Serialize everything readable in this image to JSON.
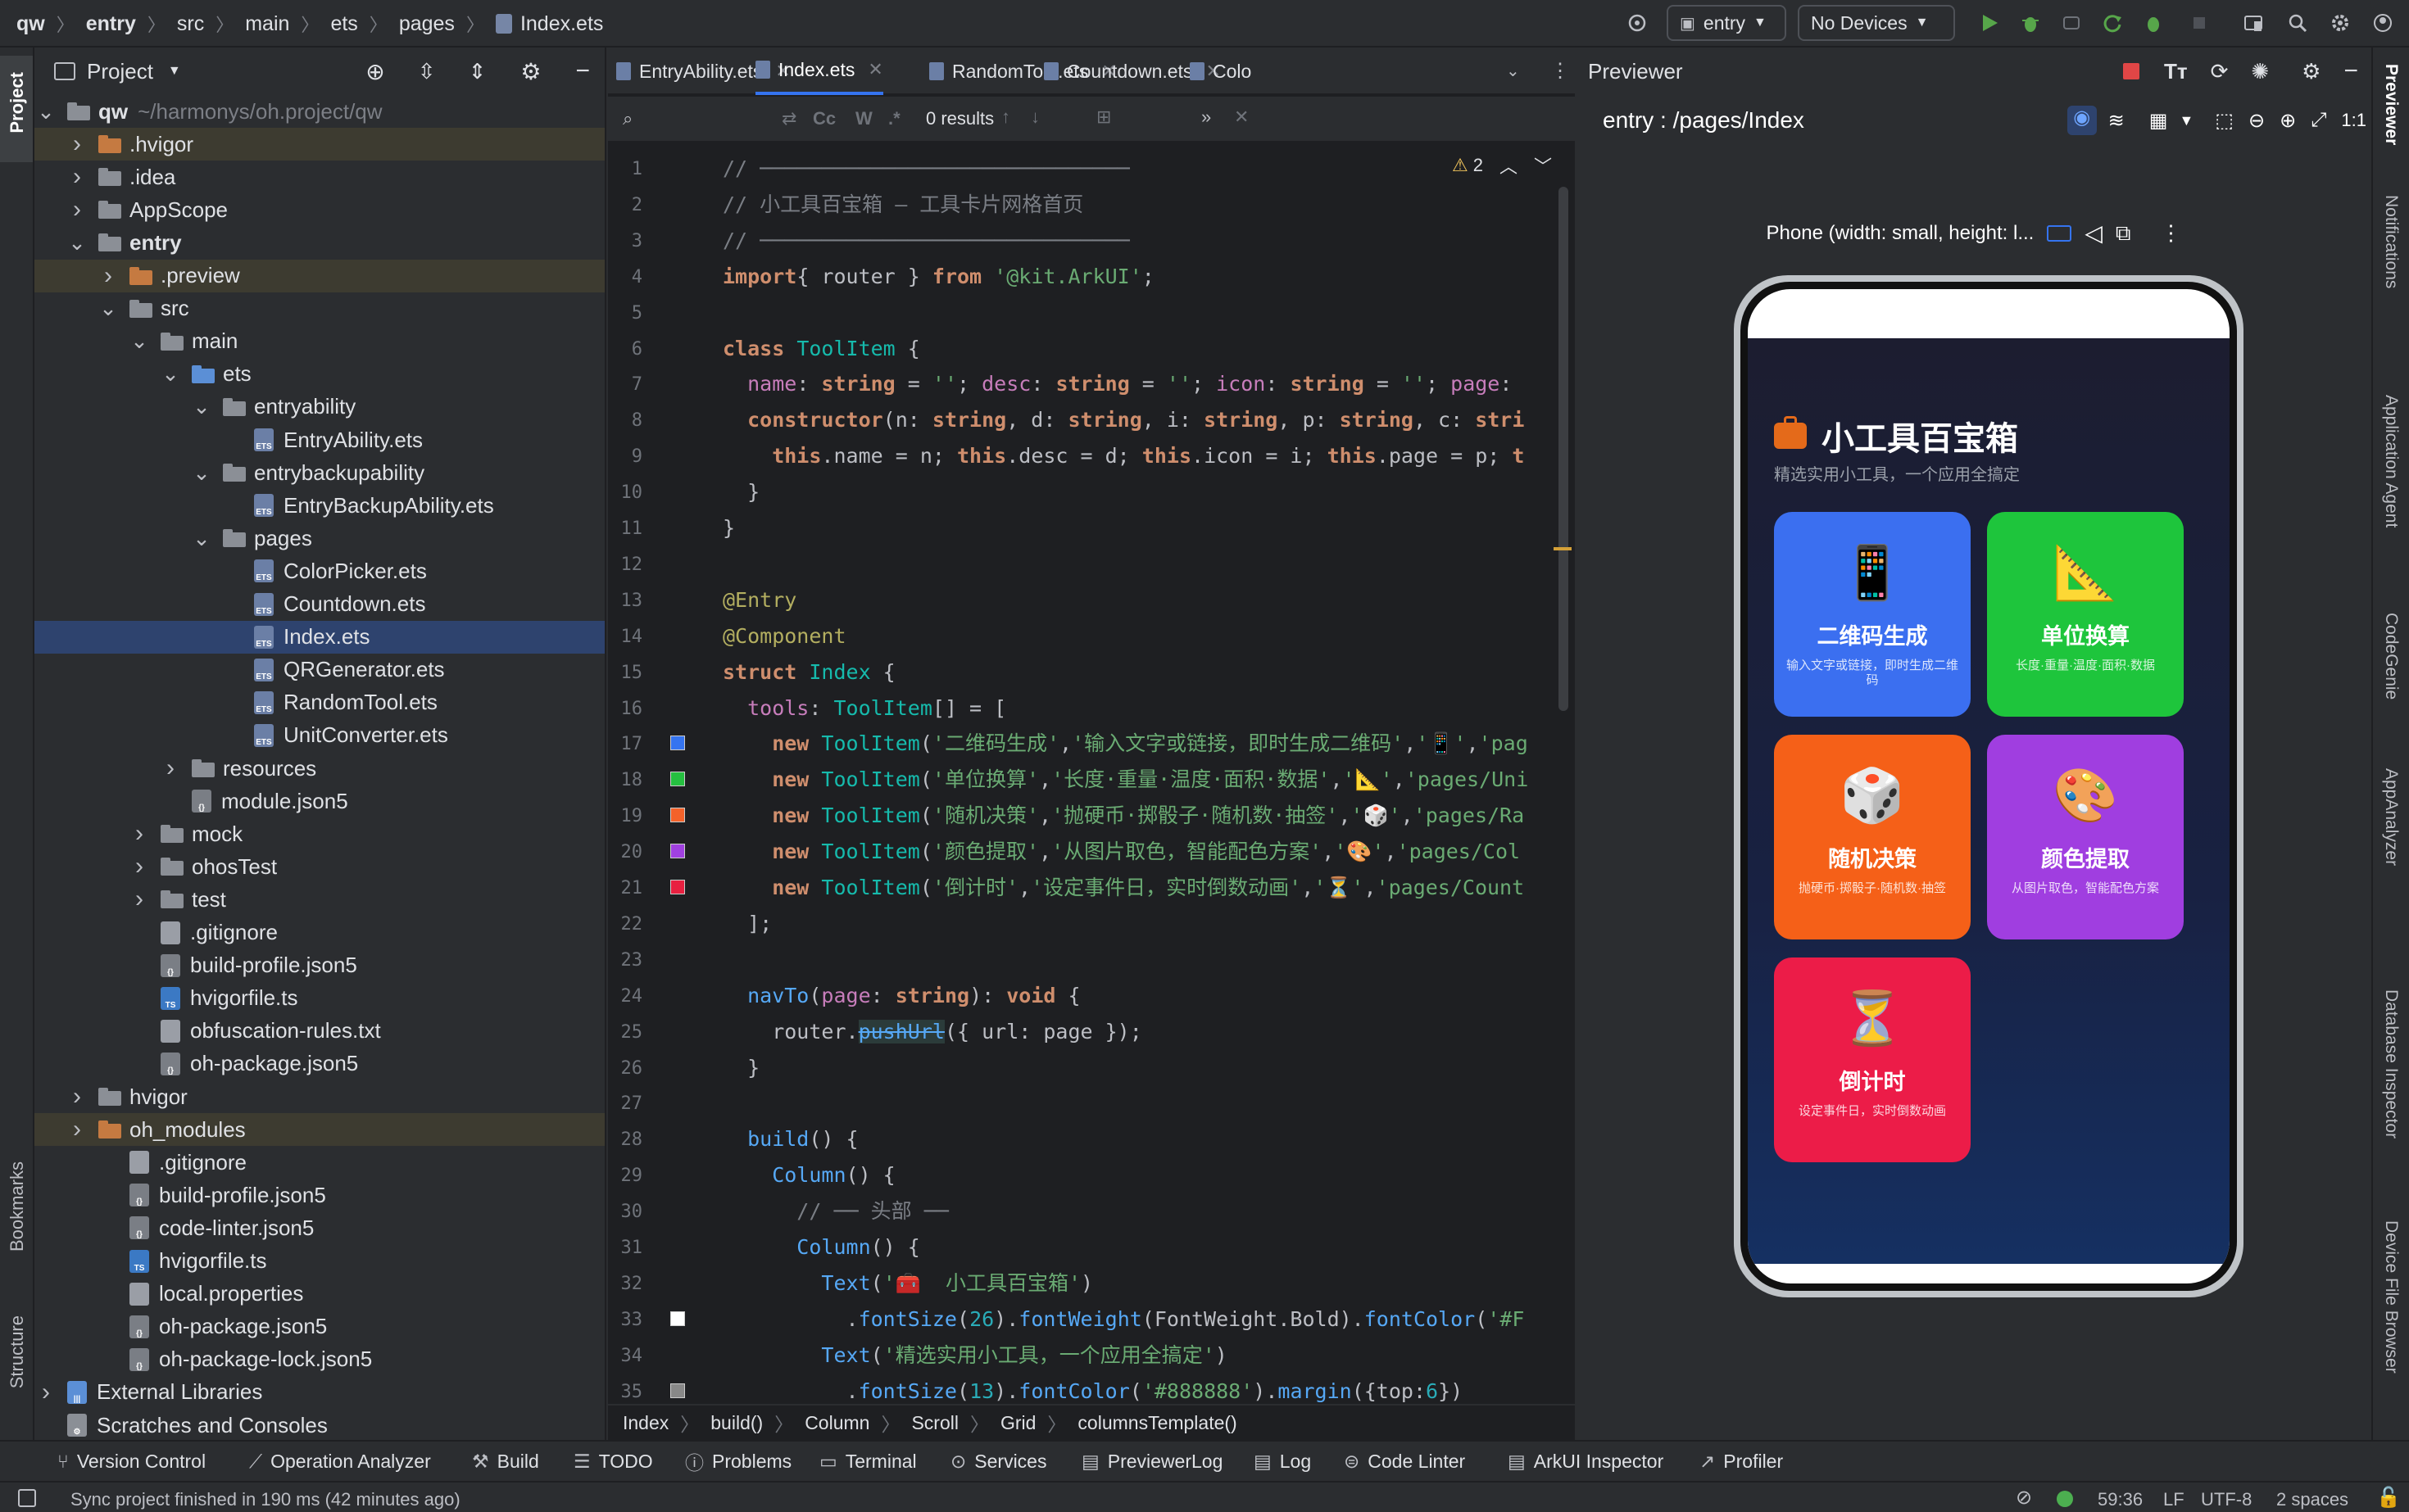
{
  "topbar": {
    "breadcrumbs": [
      "qw",
      "entry",
      "src",
      "main",
      "ets",
      "pages",
      "Index.ets"
    ],
    "run_config": "entry",
    "device": "No Devices"
  },
  "left_strip": {
    "project": "Project",
    "bookmarks": "Bookmarks",
    "structure": "Structure"
  },
  "project": {
    "title": "Project",
    "tree": [
      {
        "label": "qw",
        "extra": "~/harmonys/oh.project/qw",
        "depth": 0,
        "type": "folder",
        "open": true,
        "bold": true
      },
      {
        "label": ".hvigor",
        "depth": 1,
        "type": "folder-orange",
        "open": false,
        "hl": true
      },
      {
        "label": ".idea",
        "depth": 1,
        "type": "folder",
        "open": false
      },
      {
        "label": "AppScope",
        "depth": 1,
        "type": "folder",
        "open": false
      },
      {
        "label": "entry",
        "depth": 1,
        "type": "folder",
        "open": true,
        "bold": true
      },
      {
        "label": ".preview",
        "depth": 2,
        "type": "folder-orange",
        "open": false,
        "hl": true
      },
      {
        "label": "src",
        "depth": 2,
        "type": "folder",
        "open": true
      },
      {
        "label": "main",
        "depth": 3,
        "type": "folder",
        "open": true
      },
      {
        "label": "ets",
        "depth": 4,
        "type": "folder-blue",
        "open": true
      },
      {
        "label": "entryability",
        "depth": 5,
        "type": "folder",
        "open": true
      },
      {
        "label": "EntryAbility.ets",
        "depth": 6,
        "type": "ets"
      },
      {
        "label": "entrybackupability",
        "depth": 5,
        "type": "folder",
        "open": true
      },
      {
        "label": "EntryBackupAbility.ets",
        "depth": 6,
        "type": "ets"
      },
      {
        "label": "pages",
        "depth": 5,
        "type": "folder",
        "open": true
      },
      {
        "label": "ColorPicker.ets",
        "depth": 6,
        "type": "ets"
      },
      {
        "label": "Countdown.ets",
        "depth": 6,
        "type": "ets"
      },
      {
        "label": "Index.ets",
        "depth": 6,
        "type": "ets",
        "sel": true
      },
      {
        "label": "QRGenerator.ets",
        "depth": 6,
        "type": "ets"
      },
      {
        "label": "RandomTool.ets",
        "depth": 6,
        "type": "ets"
      },
      {
        "label": "UnitConverter.ets",
        "depth": 6,
        "type": "ets"
      },
      {
        "label": "resources",
        "depth": 4,
        "type": "folder",
        "open": false
      },
      {
        "label": "module.json5",
        "depth": 4,
        "type": "json"
      },
      {
        "label": "mock",
        "depth": 3,
        "type": "folder",
        "open": false
      },
      {
        "label": "ohosTest",
        "depth": 3,
        "type": "folder",
        "open": false
      },
      {
        "label": "test",
        "depth": 3,
        "type": "folder",
        "open": false
      },
      {
        "label": ".gitignore",
        "depth": 3,
        "type": "file"
      },
      {
        "label": "build-profile.json5",
        "depth": 3,
        "type": "json"
      },
      {
        "label": "hvigorfile.ts",
        "depth": 3,
        "type": "ts"
      },
      {
        "label": "obfuscation-rules.txt",
        "depth": 3,
        "type": "file"
      },
      {
        "label": "oh-package.json5",
        "depth": 3,
        "type": "json"
      },
      {
        "label": "hvigor",
        "depth": 1,
        "type": "folder",
        "open": false
      },
      {
        "label": "oh_modules",
        "depth": 1,
        "type": "folder-orange",
        "open": false,
        "hl": true
      },
      {
        "label": ".gitignore",
        "depth": 2,
        "type": "file"
      },
      {
        "label": "build-profile.json5",
        "depth": 2,
        "type": "json"
      },
      {
        "label": "code-linter.json5",
        "depth": 2,
        "type": "json"
      },
      {
        "label": "hvigorfile.ts",
        "depth": 2,
        "type": "ts"
      },
      {
        "label": "local.properties",
        "depth": 2,
        "type": "file"
      },
      {
        "label": "oh-package.json5",
        "depth": 2,
        "type": "json"
      },
      {
        "label": "oh-package-lock.json5",
        "depth": 2,
        "type": "json"
      },
      {
        "label": "External Libraries",
        "depth": 0,
        "type": "lib",
        "open": false
      },
      {
        "label": "Scratches and Consoles",
        "depth": 0,
        "type": "scratch"
      }
    ]
  },
  "editor": {
    "tabs": [
      "EntryAbility.ets",
      "Index.ets",
      "RandomTool.ets",
      "Countdown.ets",
      "Colo"
    ],
    "active_tab": 1,
    "find_results": "0 results",
    "warnings": "2",
    "lines": [
      [
        [
          "cm",
          "// ──────────────────────────────"
        ]
      ],
      [
        [
          "cm",
          "// 小工具百宝箱 — 工具卡片网格首页"
        ]
      ],
      [
        [
          "cm",
          "// ──────────────────────────────"
        ]
      ],
      [
        [
          "kw",
          "import"
        ],
        [
          "",
          "{ router } "
        ],
        [
          "kw",
          "from"
        ],
        [
          "st",
          " '@kit.ArkUI'"
        ],
        [
          "",
          ";"
        ]
      ],
      [],
      [
        [
          "kw",
          "class "
        ],
        [
          "ty",
          "ToolItem"
        ],
        [
          "",
          " {"
        ]
      ],
      [
        [
          "",
          ""
        ],
        [
          "pr",
          "  name"
        ],
        [
          "",
          ": "
        ],
        [
          "kw",
          "string"
        ],
        [
          "",
          " = "
        ],
        [
          "st",
          "''"
        ],
        [
          "",
          "; "
        ],
        [
          "pr",
          "desc"
        ],
        [
          "",
          ": "
        ],
        [
          "kw",
          "string"
        ],
        [
          "",
          " = "
        ],
        [
          "st",
          "''"
        ],
        [
          "",
          "; "
        ],
        [
          "pr",
          "icon"
        ],
        [
          "",
          ": "
        ],
        [
          "kw",
          "string"
        ],
        [
          "",
          " = "
        ],
        [
          "st",
          "''"
        ],
        [
          "",
          "; "
        ],
        [
          "pr",
          "page"
        ],
        [
          "",
          ":"
        ]
      ],
      [
        [
          "kw",
          "  constructor"
        ],
        [
          "",
          "(n: "
        ],
        [
          "kw",
          "string"
        ],
        [
          "",
          ", d: "
        ],
        [
          "kw",
          "string"
        ],
        [
          "",
          ", i: "
        ],
        [
          "kw",
          "string"
        ],
        [
          "",
          ", p: "
        ],
        [
          "kw",
          "string"
        ],
        [
          "",
          ", c: "
        ],
        [
          "kw",
          "stri"
        ]
      ],
      [
        [
          "kw",
          "    this"
        ],
        [
          "",
          ".name = n; "
        ],
        [
          "kw",
          "this"
        ],
        [
          "",
          ".desc = d; "
        ],
        [
          "kw",
          "this"
        ],
        [
          "",
          ".icon = i; "
        ],
        [
          "kw",
          "this"
        ],
        [
          "",
          ".page = p; "
        ],
        [
          "kw",
          "t"
        ]
      ],
      [
        [
          "",
          "  }"
        ]
      ],
      [
        [
          "",
          "}"
        ]
      ],
      [],
      [
        [
          "an",
          "@Entry"
        ]
      ],
      [
        [
          "an",
          "@Component"
        ]
      ],
      [
        [
          "kw",
          "struct "
        ],
        [
          "ty",
          "Index"
        ],
        [
          "",
          " {"
        ]
      ],
      [
        [
          "pr",
          "  tools"
        ],
        [
          "",
          ": "
        ],
        [
          "ty",
          "ToolItem"
        ],
        [
          "",
          "[] = ["
        ]
      ],
      [
        [
          "kw",
          "    new "
        ],
        [
          "ty",
          "ToolItem"
        ],
        [
          "",
          "("
        ],
        [
          "st",
          "'二维码生成'"
        ],
        [
          "",
          ","
        ],
        [
          "st",
          "'输入文字或链接，即时生成二维码'"
        ],
        [
          "",
          ","
        ],
        [
          "st",
          "'📱'"
        ],
        [
          "",
          ","
        ],
        [
          "st",
          "'pag"
        ]
      ],
      [
        [
          "kw",
          "    new "
        ],
        [
          "ty",
          "ToolItem"
        ],
        [
          "",
          "("
        ],
        [
          "st",
          "'单位换算'"
        ],
        [
          "",
          ","
        ],
        [
          "st",
          "'长度·重量·温度·面积·数据'"
        ],
        [
          "",
          ","
        ],
        [
          "st",
          "'📐'"
        ],
        [
          "",
          ","
        ],
        [
          "st",
          "'pages/Uni"
        ]
      ],
      [
        [
          "kw",
          "    new "
        ],
        [
          "ty",
          "ToolItem"
        ],
        [
          "",
          "("
        ],
        [
          "st",
          "'随机决策'"
        ],
        [
          "",
          ","
        ],
        [
          "st",
          "'抛硬币·掷骰子·随机数·抽签'"
        ],
        [
          "",
          ","
        ],
        [
          "st",
          "'🎲'"
        ],
        [
          "",
          ","
        ],
        [
          "st",
          "'pages/Ra"
        ]
      ],
      [
        [
          "kw",
          "    new "
        ],
        [
          "ty",
          "ToolItem"
        ],
        [
          "",
          "("
        ],
        [
          "st",
          "'颜色提取'"
        ],
        [
          "",
          ","
        ],
        [
          "st",
          "'从图片取色，智能配色方案'"
        ],
        [
          "",
          ","
        ],
        [
          "st",
          "'🎨'"
        ],
        [
          "",
          ","
        ],
        [
          "st",
          "'pages/Col"
        ]
      ],
      [
        [
          "kw",
          "    new "
        ],
        [
          "ty",
          "ToolItem"
        ],
        [
          "",
          "("
        ],
        [
          "st",
          "'倒计时'"
        ],
        [
          "",
          ","
        ],
        [
          "st",
          "'设定事件日，实时倒数动画'"
        ],
        [
          "",
          ","
        ],
        [
          "st",
          "'⏳'"
        ],
        [
          "",
          ","
        ],
        [
          "st",
          "'pages/Count"
        ]
      ],
      [
        [
          "",
          "  ];"
        ]
      ],
      [],
      [
        [
          "fn",
          "  navTo"
        ],
        [
          "",
          "("
        ],
        [
          "pr",
          "page"
        ],
        [
          "",
          ": "
        ],
        [
          "kw",
          "string"
        ],
        [
          "",
          "): "
        ],
        [
          "kw",
          "void"
        ],
        [
          "",
          " {"
        ]
      ],
      [
        [
          "",
          "    router."
        ],
        [
          "fn",
          "pushUrl"
        ],
        [
          "",
          "({ url: page });"
        ]
      ],
      [
        [
          "",
          "  }"
        ]
      ],
      [],
      [
        [
          "fn",
          "  build"
        ],
        [
          "",
          "() {"
        ]
      ],
      [
        [
          "fn",
          "    Column"
        ],
        [
          "",
          "() {"
        ]
      ],
      [
        [
          "cm",
          "      // ── 头部 ──"
        ]
      ],
      [
        [
          "fn",
          "      Column"
        ],
        [
          "",
          "() {"
        ]
      ],
      [
        [
          "fn",
          "        Text"
        ],
        [
          "",
          "("
        ],
        [
          "st",
          "'🧰  小工具百宝箱'"
        ],
        [
          "",
          ")"
        ]
      ],
      [
        [
          "",
          "          ."
        ],
        [
          "fn",
          "fontSize"
        ],
        [
          "",
          "("
        ],
        [
          "nb",
          "26"
        ],
        [
          "",
          ")."
        ],
        [
          "fn",
          "fontWeight"
        ],
        [
          "",
          "(FontWeight.Bold)."
        ],
        [
          "fn",
          "fontColor"
        ],
        [
          "",
          "("
        ],
        [
          "st",
          "'#F"
        ]
      ],
      [
        [
          "fn",
          "        Text"
        ],
        [
          "",
          "("
        ],
        [
          "st",
          "'精选实用小工具，一个应用全搞定'"
        ],
        [
          "",
          ")"
        ]
      ],
      [
        [
          "",
          "          ."
        ],
        [
          "fn",
          "fontSize"
        ],
        [
          "",
          "("
        ],
        [
          "nb",
          "13"
        ],
        [
          "",
          ")."
        ],
        [
          "fn",
          "fontColor"
        ],
        [
          "",
          "("
        ],
        [
          "st",
          "'#888888'"
        ],
        [
          "",
          ")."
        ],
        [
          "fn",
          "margin"
        ],
        [
          "",
          "({top:"
        ],
        [
          "nb",
          "6"
        ],
        [
          "",
          "})"
        ]
      ]
    ],
    "swatch_lines": {
      "17": "#3574f0",
      "18": "#25c040",
      "19": "#f4622a",
      "20": "#a040e0",
      "21": "#e82040",
      "33": "#ffffff",
      "35": "#888888"
    },
    "breadcrumb": [
      "Index",
      "build()",
      "Column",
      "Scroll",
      "Grid",
      "columnsTemplate()"
    ]
  },
  "previewer": {
    "title": "Previewer",
    "path": "entry : /pages/Index",
    "device_label": "Phone (width: small, height: l...",
    "app": {
      "title": "小工具百宝箱",
      "subtitle": "精选实用小工具，一个应用全搞定",
      "cards": [
        {
          "name": "二维码生成",
          "desc": "输入文字或链接，即时生成二维码",
          "icon": "📱",
          "color": "#3b6ff0"
        },
        {
          "name": "单位换算",
          "desc": "长度·重量·温度·面积·数据",
          "icon": "📐",
          "color": "#1ec53c"
        },
        {
          "name": "随机决策",
          "desc": "抛硬币·掷骰子·随机数·抽签",
          "icon": "🎲",
          "color": "#f56018"
        },
        {
          "name": "颜色提取",
          "desc": "从图片取色，智能配色方案",
          "icon": "🎨",
          "color": "#a03ee0"
        },
        {
          "name": "倒计时",
          "desc": "设定事件日，实时倒数动画",
          "icon": "⏳",
          "color": "#ec1c48"
        }
      ]
    }
  },
  "right_strip": [
    "Previewer",
    "Notifications",
    "Application Agent",
    "CodeGenie",
    "AppAnalyzer",
    "Database Inspector",
    "Device File Browser"
  ],
  "toolwindows": [
    "Version Control",
    "Operation Analyzer",
    "Build",
    "TODO",
    "Problems",
    "Terminal",
    "Services",
    "PreviewerLog",
    "Log",
    "Code Linter",
    "ArkUI Inspector",
    "Profiler"
  ],
  "status": {
    "message": "Sync project finished in 190 ms (42 minutes ago)",
    "position": "59:36",
    "line_sep": "LF",
    "encoding": "UTF-8",
    "indent": "2 spaces"
  }
}
